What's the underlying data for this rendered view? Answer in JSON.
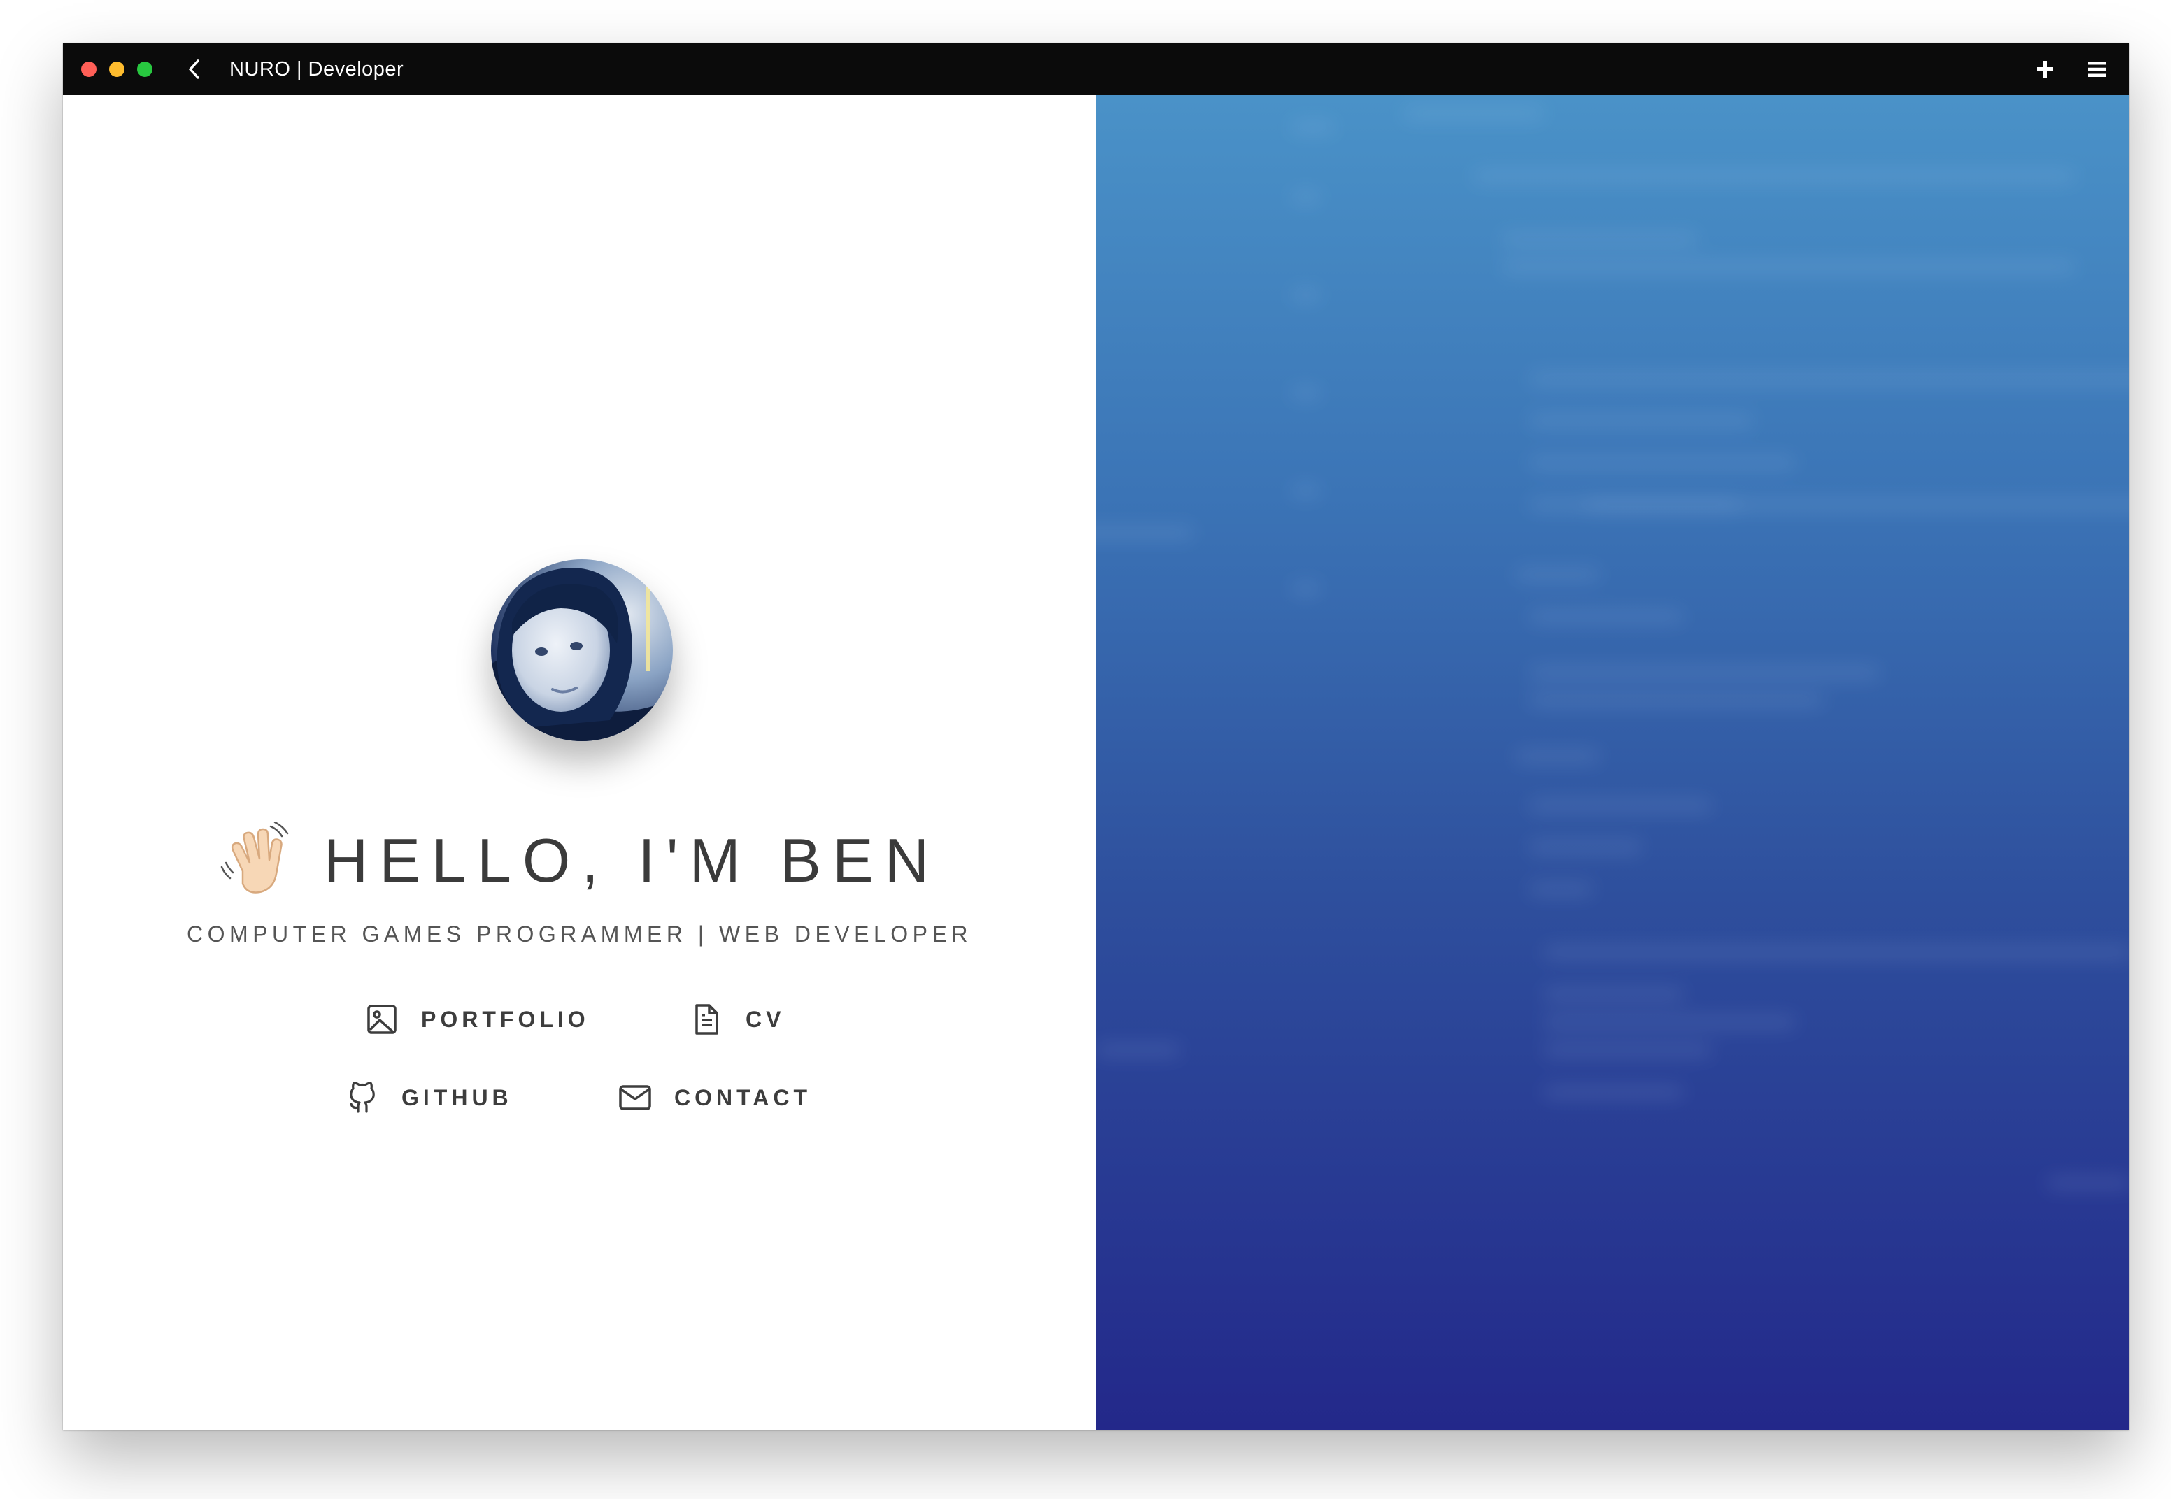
{
  "window": {
    "tab_title": "NURO | Developer",
    "traffic_lights": {
      "close": "#ff5f57",
      "minimize": "#febc2e",
      "maximize": "#28c840"
    },
    "icons": {
      "back": "chevron-left-icon",
      "new_tab": "plus-icon",
      "menu": "hamburger-menu-icon"
    }
  },
  "hero": {
    "avatar_alt": "profile photo",
    "wave_icon": "waving-hand-icon",
    "headline": "HELLO, I'M BEN",
    "subtitle": "COMPUTER GAMES PROGRAMMER | WEB DEVELOPER"
  },
  "links": [
    {
      "label": "PORTFOLIO",
      "icon": "image-icon"
    },
    {
      "label": "CV",
      "icon": "document-icon"
    },
    {
      "label": "GITHUB",
      "icon": "github-icon"
    },
    {
      "label": "CONTACT",
      "icon": "mail-icon"
    }
  ],
  "colors": {
    "titlebar": "#0b0b0b",
    "text": "#3b3b3b",
    "gradient_top": "#4a92c8",
    "gradient_bottom": "#23288a"
  }
}
